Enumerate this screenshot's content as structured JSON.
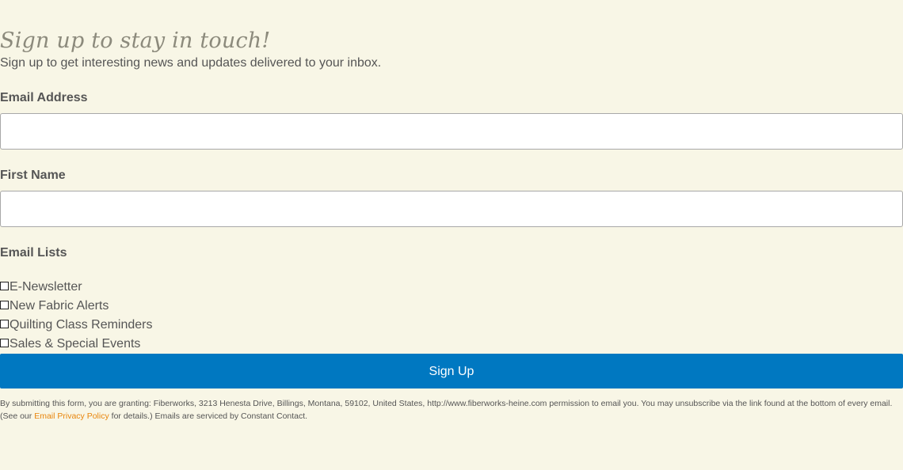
{
  "header": {
    "title": "Sign up to stay in touch!",
    "subtitle": "Sign up to get interesting news and updates delivered to your inbox."
  },
  "fields": {
    "email": {
      "label": "Email Address",
      "value": "",
      "placeholder": ""
    },
    "first_name": {
      "label": "First Name",
      "value": "",
      "placeholder": ""
    }
  },
  "lists": {
    "label": "Email Lists",
    "items": [
      {
        "label": "E-Newsletter",
        "checked": false
      },
      {
        "label": "New Fabric Alerts",
        "checked": false
      },
      {
        "label": "Quilting Class Reminders",
        "checked": false
      },
      {
        "label": "Sales & Special Events",
        "checked": false
      }
    ]
  },
  "submit": {
    "label": "Sign Up"
  },
  "legal": {
    "text_before": "By submitting this form, you are granting: Fiberworks, 3213 Henesta Drive, Billings, Montana, 59102, United States, http://www.fiberworks-heine.com permission to email you. You may unsubscribe via the link found at the bottom of every email. (See our ",
    "link_label": "Email Privacy Policy",
    "text_after": " for details.) Emails are serviced by Constant Contact."
  },
  "colors": {
    "background": "#f8f6e6",
    "button": "#0078c1",
    "link": "#e8850c"
  }
}
